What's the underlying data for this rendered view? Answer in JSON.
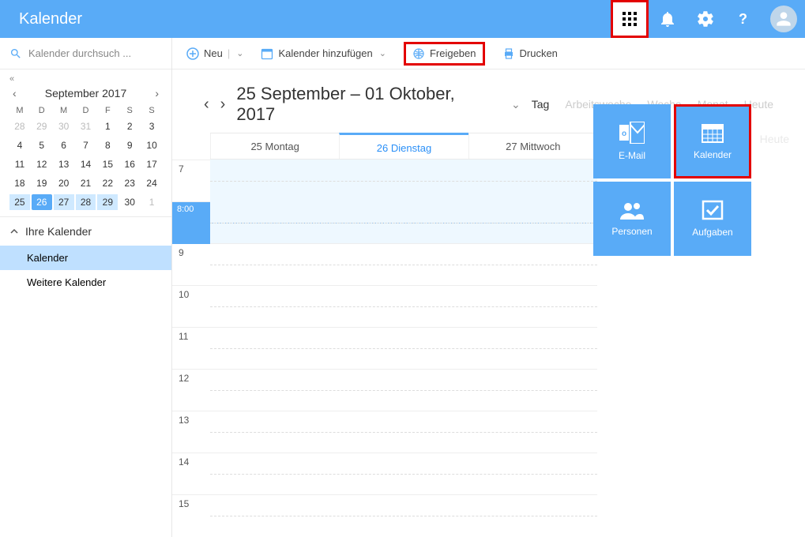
{
  "header": {
    "title": "Kalender"
  },
  "search": {
    "placeholder": "Kalender durchsuch ..."
  },
  "miniCal": {
    "topMark": "«",
    "title": "September 2017",
    "weekdays": [
      "M",
      "D",
      "M",
      "D",
      "F",
      "S",
      "S"
    ],
    "rows": [
      [
        {
          "d": "28",
          "o": true
        },
        {
          "d": "29",
          "o": true
        },
        {
          "d": "30",
          "o": true
        },
        {
          "d": "31",
          "o": true
        },
        {
          "d": "1"
        },
        {
          "d": "2"
        },
        {
          "d": "3"
        }
      ],
      [
        {
          "d": "4"
        },
        {
          "d": "5"
        },
        {
          "d": "6"
        },
        {
          "d": "7"
        },
        {
          "d": "8"
        },
        {
          "d": "9"
        },
        {
          "d": "10"
        }
      ],
      [
        {
          "d": "11"
        },
        {
          "d": "12"
        },
        {
          "d": "13"
        },
        {
          "d": "14"
        },
        {
          "d": "15"
        },
        {
          "d": "16"
        },
        {
          "d": "17"
        }
      ],
      [
        {
          "d": "18"
        },
        {
          "d": "19"
        },
        {
          "d": "20"
        },
        {
          "d": "21"
        },
        {
          "d": "22"
        },
        {
          "d": "23"
        },
        {
          "d": "24"
        }
      ],
      [
        {
          "d": "25",
          "wk": true
        },
        {
          "d": "26",
          "sel": true
        },
        {
          "d": "27",
          "wk": true
        },
        {
          "d": "28",
          "wk": true
        },
        {
          "d": "29",
          "wk": true
        },
        {
          "d": "30"
        },
        {
          "d": "1",
          "o": true
        }
      ]
    ]
  },
  "calList": {
    "sectionTitle": "Ihre Kalender",
    "items": [
      "Kalender",
      "Weitere Kalender"
    ],
    "activeIndex": 0
  },
  "toolbar": {
    "new": "Neu",
    "addCal": "Kalender hinzufügen",
    "share": "Freigeben",
    "print": "Drucken"
  },
  "dateHeader": {
    "title": "25 September – 01 Oktober, 2017",
    "views": [
      "Tag",
      "Arbeitswoche",
      "Woche",
      "Monat",
      "Heute"
    ]
  },
  "heuteGhost": "Heute",
  "dayCols": [
    {
      "label": "25 Montag"
    },
    {
      "label": "26 Dienstag",
      "active": true
    },
    {
      "label": "27 Mittwoch"
    }
  ],
  "hours": [
    "7",
    "8:00",
    "9",
    "10",
    "11",
    "12",
    "13",
    "14",
    "15"
  ],
  "tiles": [
    {
      "label": "E-Mail",
      "icon": "mail"
    },
    {
      "label": "Kalender",
      "icon": "cal",
      "hl": true
    },
    {
      "label": "Personen",
      "icon": "people"
    },
    {
      "label": "Aufgaben",
      "icon": "tasks"
    }
  ]
}
